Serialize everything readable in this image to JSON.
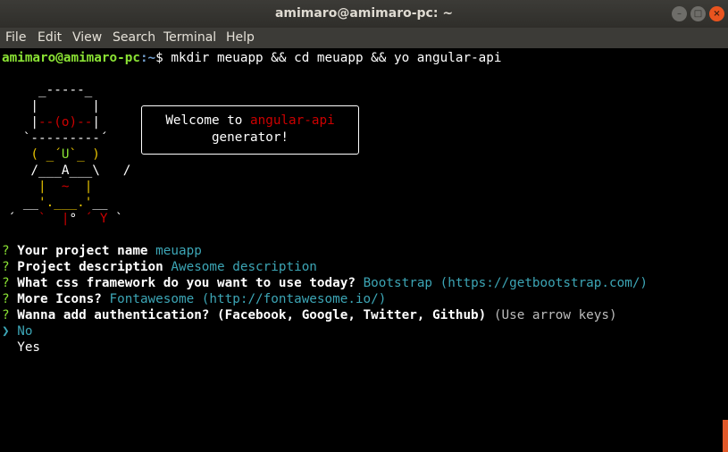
{
  "window": {
    "title": "amimaro@amimaro-pc: ~"
  },
  "menu": [
    "File",
    "Edit",
    "View",
    "Search",
    "Terminal",
    "Help"
  ],
  "prompt": {
    "user_host": "amimaro@amimaro-pc",
    "path": ":~",
    "symbol": "$",
    "command": " mkdir meuapp && cd meuapp && yo angular-api"
  },
  "ascii": {
    "l1": "     _-----_",
    "l2": "    |       |",
    "l3": "    |--(o)--|",
    "l4": "   `---------´",
    "l5": "    ( _´U`_ )",
    "l6": "    /___A___\\   /",
    "l7": "     |  ~  |",
    "l8": "   __'.___.'__",
    "l9a": " ´   ",
    "l9b": "`  |",
    "l9c": "° ",
    "l9d": "´ Y ",
    "l9e": "`"
  },
  "welcome": {
    "line1_prefix": "Welcome to ",
    "line1_highlight": "angular-api",
    "line2": "generator!"
  },
  "questions": [
    {
      "mark": "?",
      "question": " Your project name ",
      "answer": "meuapp"
    },
    {
      "mark": "?",
      "question": " Project description ",
      "answer": "Awesome description"
    },
    {
      "mark": "?",
      "question": " What css framework do you want to use today? ",
      "answer": "Bootstrap (https://getbootstrap.com/)"
    },
    {
      "mark": "?",
      "question": " More Icons? ",
      "answer": "Fontawesome (http://fontawesome.io/)"
    },
    {
      "mark": "?",
      "question": " Wanna add authentication? (Facebook, Google, Twitter, Github) ",
      "answer": "(Use arrow keys)"
    }
  ],
  "choices": {
    "pointer": "❯",
    "selected": " No",
    "other": "  Yes"
  },
  "colors": {
    "prompt_green": "#8ae234",
    "path_blue": "#729fcf",
    "answer_cyan": "#3ca5b5",
    "mark_yellow": "#e6c200",
    "highlight_red": "#cc0000"
  }
}
